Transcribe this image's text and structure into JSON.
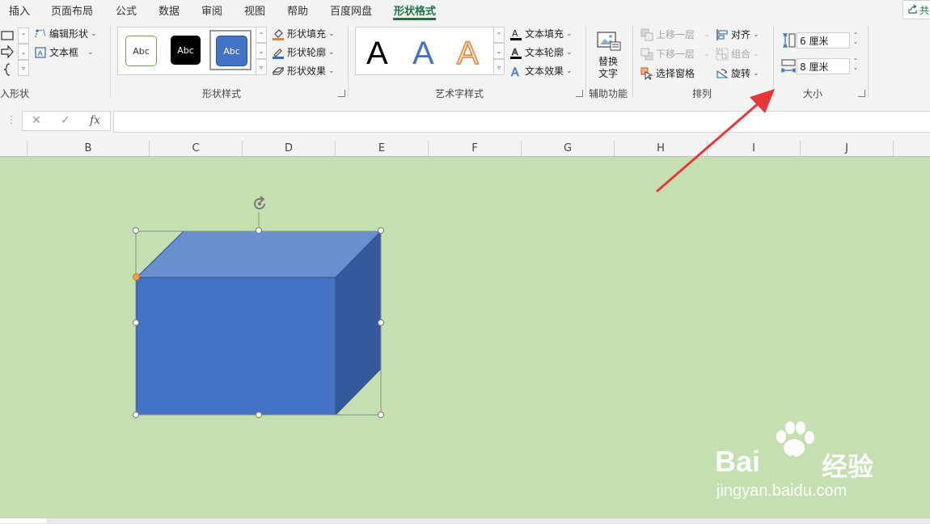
{
  "tabs": [
    {
      "label": "插入"
    },
    {
      "label": "页面布局"
    },
    {
      "label": "公式"
    },
    {
      "label": "数据"
    },
    {
      "label": "审阅"
    },
    {
      "label": "视图"
    },
    {
      "label": "帮助"
    },
    {
      "label": "百度网盘"
    },
    {
      "label": "形状格式",
      "active": true
    }
  ],
  "share_label": "共",
  "insert_shapes": {
    "edit_shape": "编辑形状",
    "text_box": "文本框",
    "group_label": "入形状"
  },
  "shape_styles": {
    "swatches": [
      "Abc",
      "Abc",
      "Abc"
    ],
    "fill": "形状填充",
    "outline": "形状轮廓",
    "effects": "形状效果",
    "group_label": "形状样式"
  },
  "wordart": {
    "letters": [
      "A",
      "A",
      "A"
    ],
    "text_fill": "文本填充",
    "text_outline": "文本轮廓",
    "text_effects": "文本效果",
    "group_label": "艺术字样式"
  },
  "accessibility": {
    "alt_text_line1": "替换",
    "alt_text_line2": "文字",
    "group_label": "辅助功能"
  },
  "arrange": {
    "bring_forward": "上移一层",
    "send_backward": "下移一层",
    "selection_pane": "选择窗格",
    "align": "对齐",
    "group": "组合",
    "rotate": "旋转",
    "group_label": "排列"
  },
  "size": {
    "height_value": "6 厘米",
    "width_value": "8 厘米",
    "group_label": "大小"
  },
  "formula_bar": {
    "cancel": "✕",
    "enter": "✓",
    "fx": "fx",
    "value": ""
  },
  "columns": [
    "B",
    "C",
    "D",
    "E",
    "F",
    "G",
    "H",
    "I",
    "J"
  ],
  "watermark": {
    "brand_a": "Bai",
    "brand_b": "du",
    "brand_c": "经验",
    "url": "jingyan.baidu.com"
  },
  "colors": {
    "accent": "#217346",
    "sheet_bg": "#c4dfb0",
    "cube_front": "#4472c4",
    "cube_top": "#6a8fcf",
    "cube_side": "#36599e",
    "arrow": "#e8353a"
  }
}
